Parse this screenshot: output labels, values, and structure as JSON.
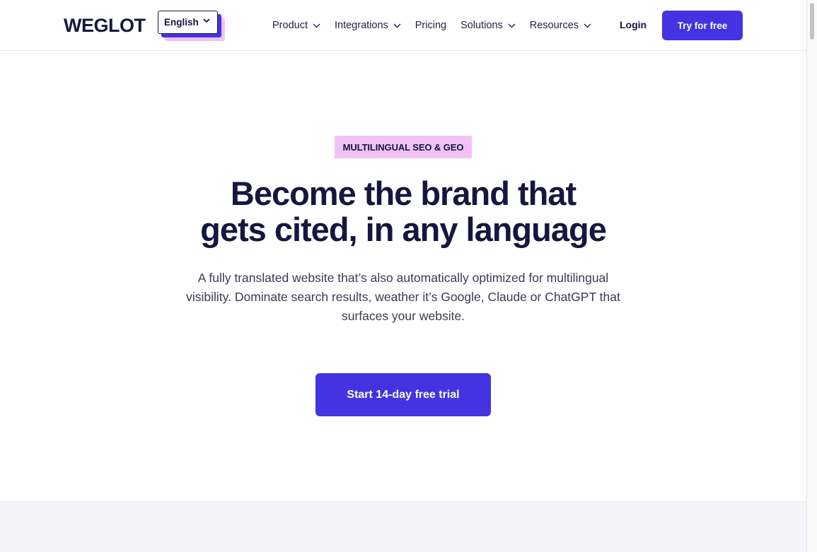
{
  "header": {
    "logo": "WEGLOT",
    "language": "English",
    "nav": [
      {
        "label": "Product",
        "has_dropdown": true
      },
      {
        "label": "Integrations",
        "has_dropdown": true
      },
      {
        "label": "Pricing",
        "has_dropdown": false
      },
      {
        "label": "Solutions",
        "has_dropdown": true
      },
      {
        "label": "Resources",
        "has_dropdown": true
      }
    ],
    "login": "Login",
    "try_button": "Try for free"
  },
  "hero": {
    "badge": "MULTILINGUAL SEO & GEO",
    "title_line1": "Become the brand that",
    "title_line2": "gets cited, in any language",
    "description_line1": "A fully translated website that’s also automatically optimized for multilingual",
    "description_line2": "visibility. Dominate search results, weather it’s Google, Claude or ChatGPT that",
    "description_line3": "surfaces your website.",
    "cta": "Start 14-day free trial"
  },
  "colors": {
    "primary": "#4433e0",
    "accent_pink": "#f2c2f5",
    "text_dark": "#16163f"
  },
  "icons": {
    "dropdown": "chevron-down-icon"
  }
}
